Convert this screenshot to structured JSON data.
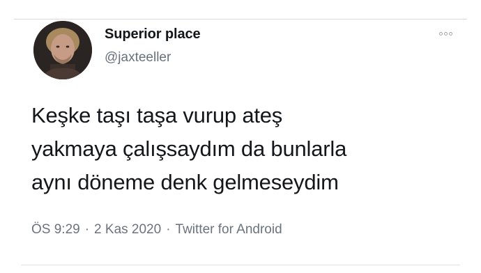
{
  "tweet": {
    "display_name": "Superior place",
    "handle": "@jaxteeller",
    "text_lines": [
      "Keşke taşı taşa vurup ateş",
      "yakmaya çalışsaydım da bunlarla",
      "aynı döneme denk gelmeseydim"
    ],
    "time": "ÖS 9:29",
    "date": "2 Kas 2020",
    "source": "Twitter for Android",
    "separator": "·"
  },
  "icons": {
    "more": "more-options-icon",
    "avatar": "profile-avatar"
  },
  "colors": {
    "text": "#14171a",
    "secondary": "#66717b",
    "divider": "#d9d9d9"
  }
}
